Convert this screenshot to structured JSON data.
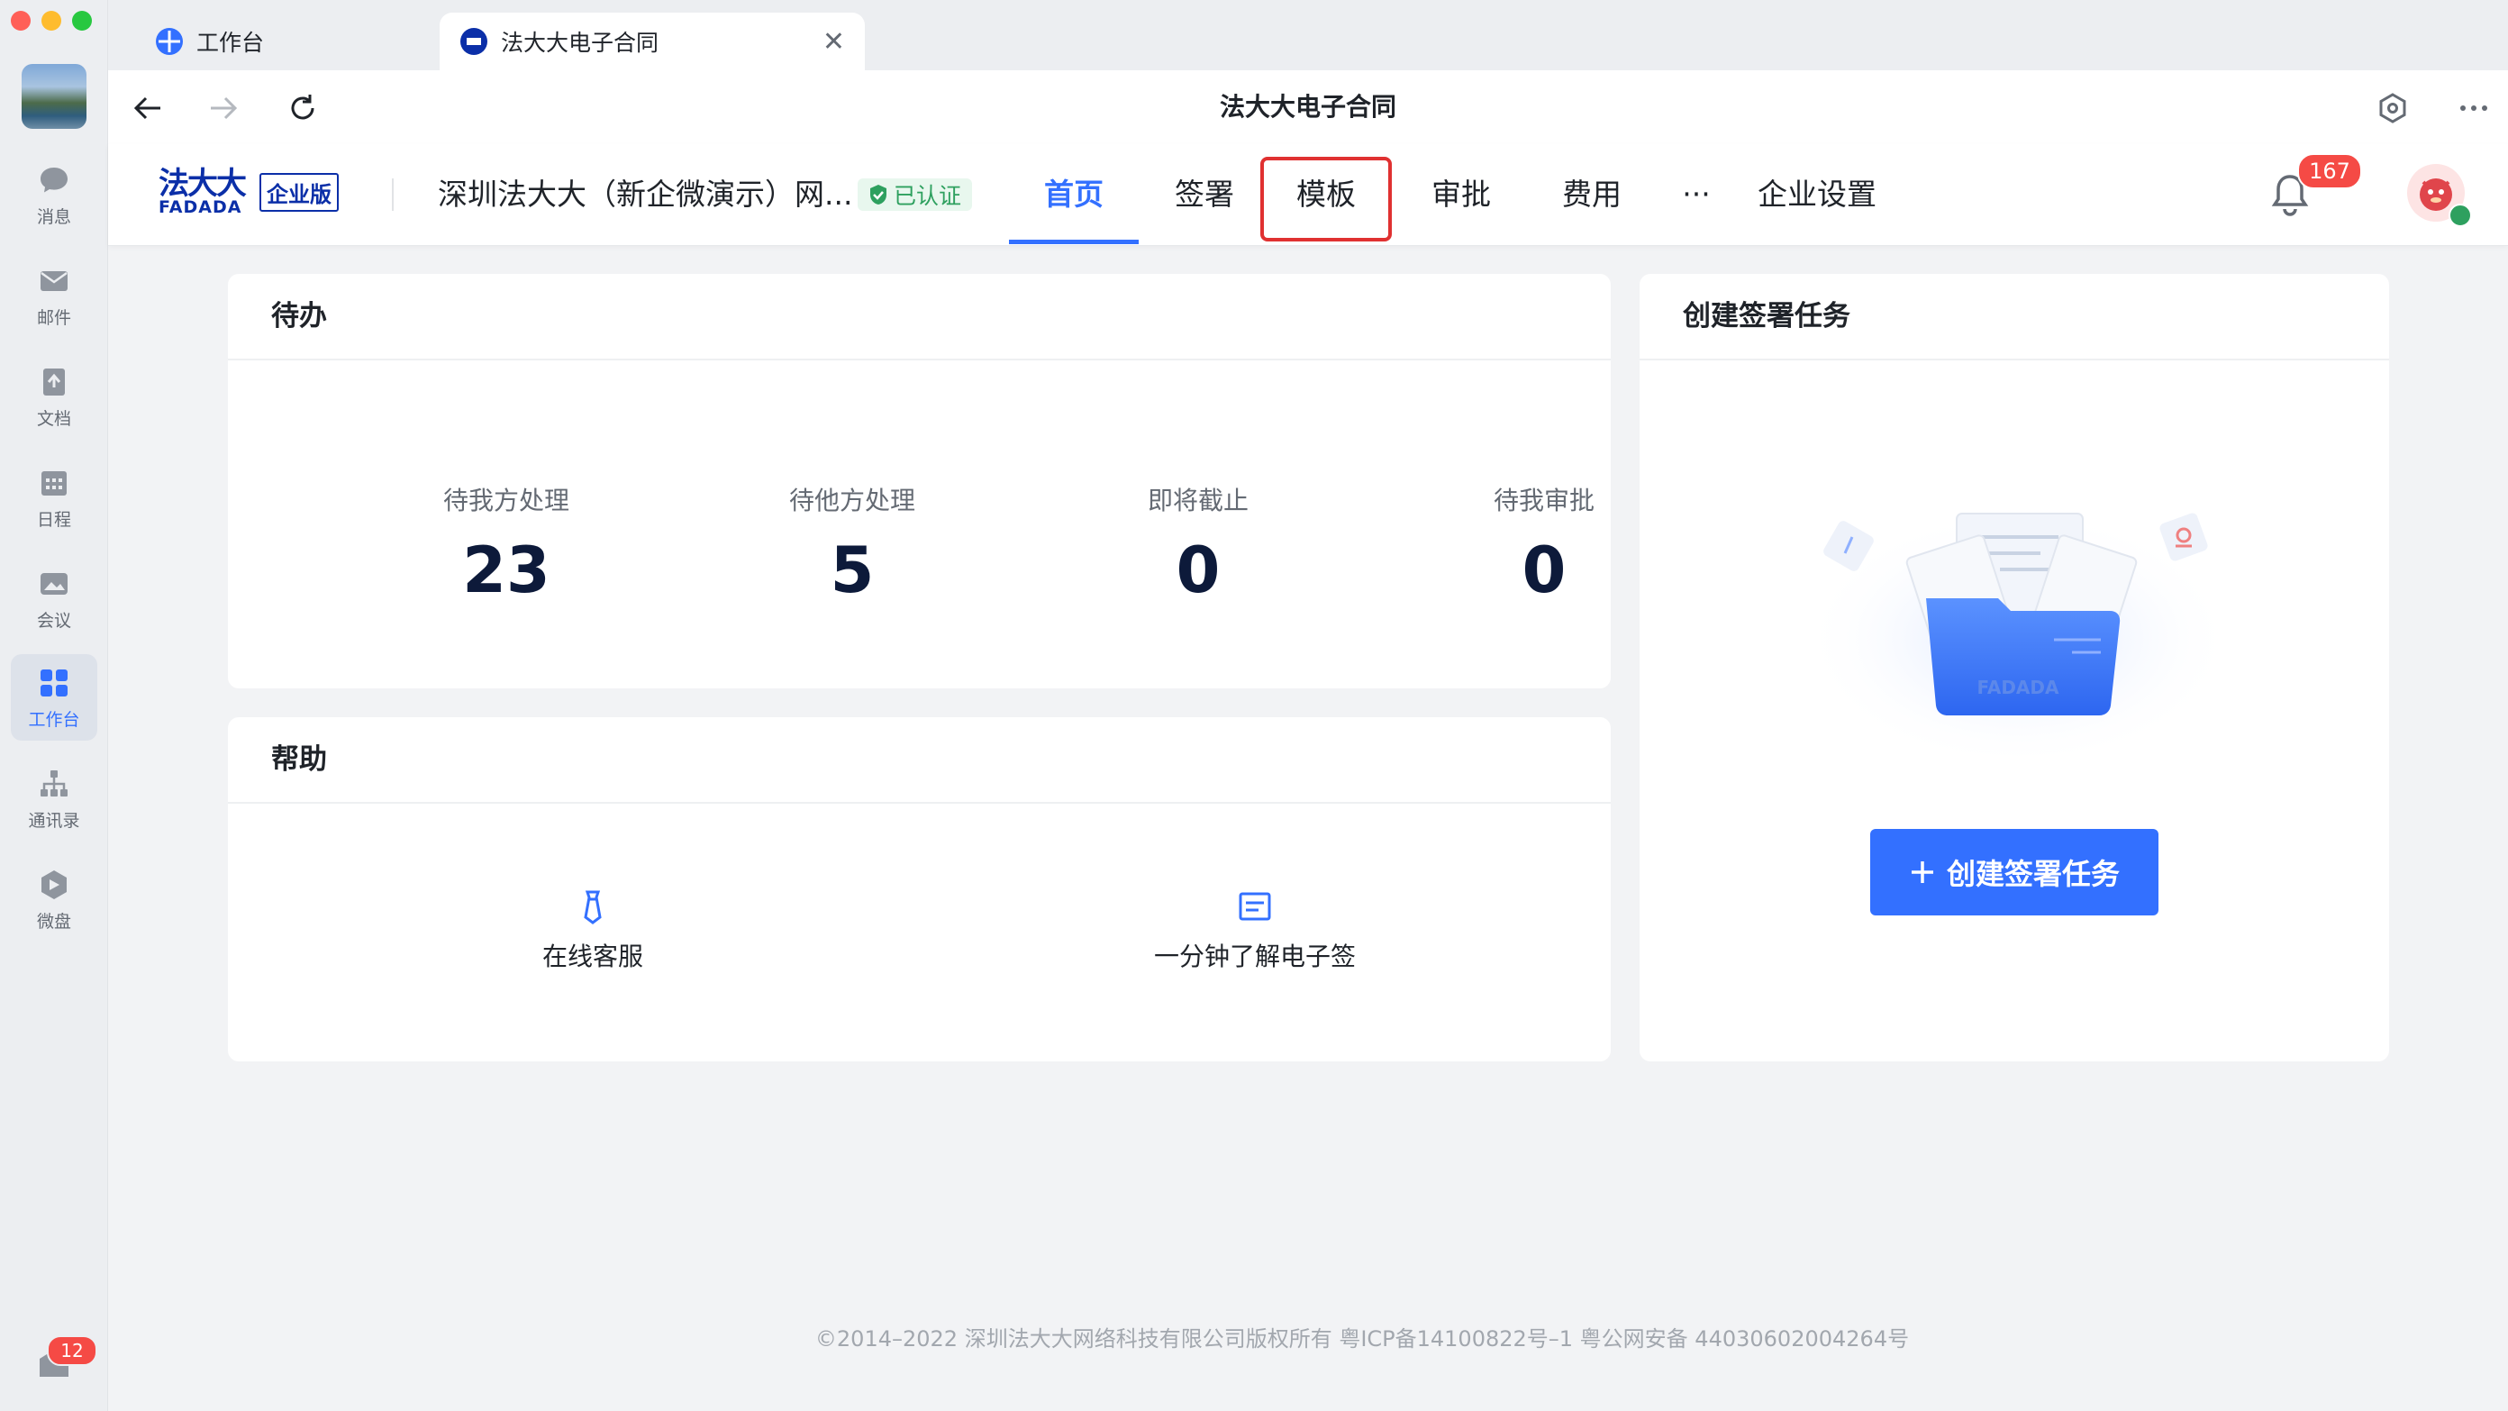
{
  "rail": {
    "items": [
      {
        "label": "消息",
        "icon": "chat-bubble-icon"
      },
      {
        "label": "邮件",
        "icon": "mail-icon"
      },
      {
        "label": "文档",
        "icon": "document-icon"
      },
      {
        "label": "日程",
        "icon": "calendar-icon"
      },
      {
        "label": "会议",
        "icon": "meeting-icon"
      },
      {
        "label": "工作台",
        "icon": "workspace-grid-icon"
      },
      {
        "label": "通讯录",
        "icon": "org-chart-icon"
      },
      {
        "label": "微盘",
        "icon": "cloud-drive-icon"
      }
    ],
    "bottom_badge": "12"
  },
  "tabs": [
    {
      "title": "工作台"
    },
    {
      "title": "法大大电子合同"
    }
  ],
  "toolbar": {
    "title": "法大大电子合同"
  },
  "header": {
    "logo_cn": "法大大",
    "logo_en": "FADADA",
    "edition": "企业版",
    "company": "深圳法大大（新企微演示）网...",
    "verified": "已认证",
    "nav": [
      "首页",
      "签署",
      "模板",
      "审批",
      "费用",
      "···",
      "企业设置"
    ],
    "notifications": "167"
  },
  "todo": {
    "title": "待办",
    "stats": [
      {
        "label": "待我方处理",
        "value": "23"
      },
      {
        "label": "待他方处理",
        "value": "5"
      },
      {
        "label": "即将截止",
        "value": "0"
      },
      {
        "label": "待我审批",
        "value": "0"
      }
    ]
  },
  "help": {
    "title": "帮助",
    "items": [
      {
        "label": "在线客服",
        "icon": "customer-service-icon"
      },
      {
        "label": "一分钟了解电子签",
        "icon": "guide-doc-icon"
      }
    ]
  },
  "create": {
    "title": "创建签署任务",
    "button": "创建签署任务",
    "illus_text": "FADADA"
  },
  "footer": "©2014–2022 深圳法大大网络科技有限公司版权所有 粤ICP备14100822号–1 粤公网安备 44030602004264号",
  "colors": {
    "accent": "#3370ff",
    "highlight": "#e03131",
    "badge": "#f54a45",
    "verified": "#2ea05f"
  }
}
